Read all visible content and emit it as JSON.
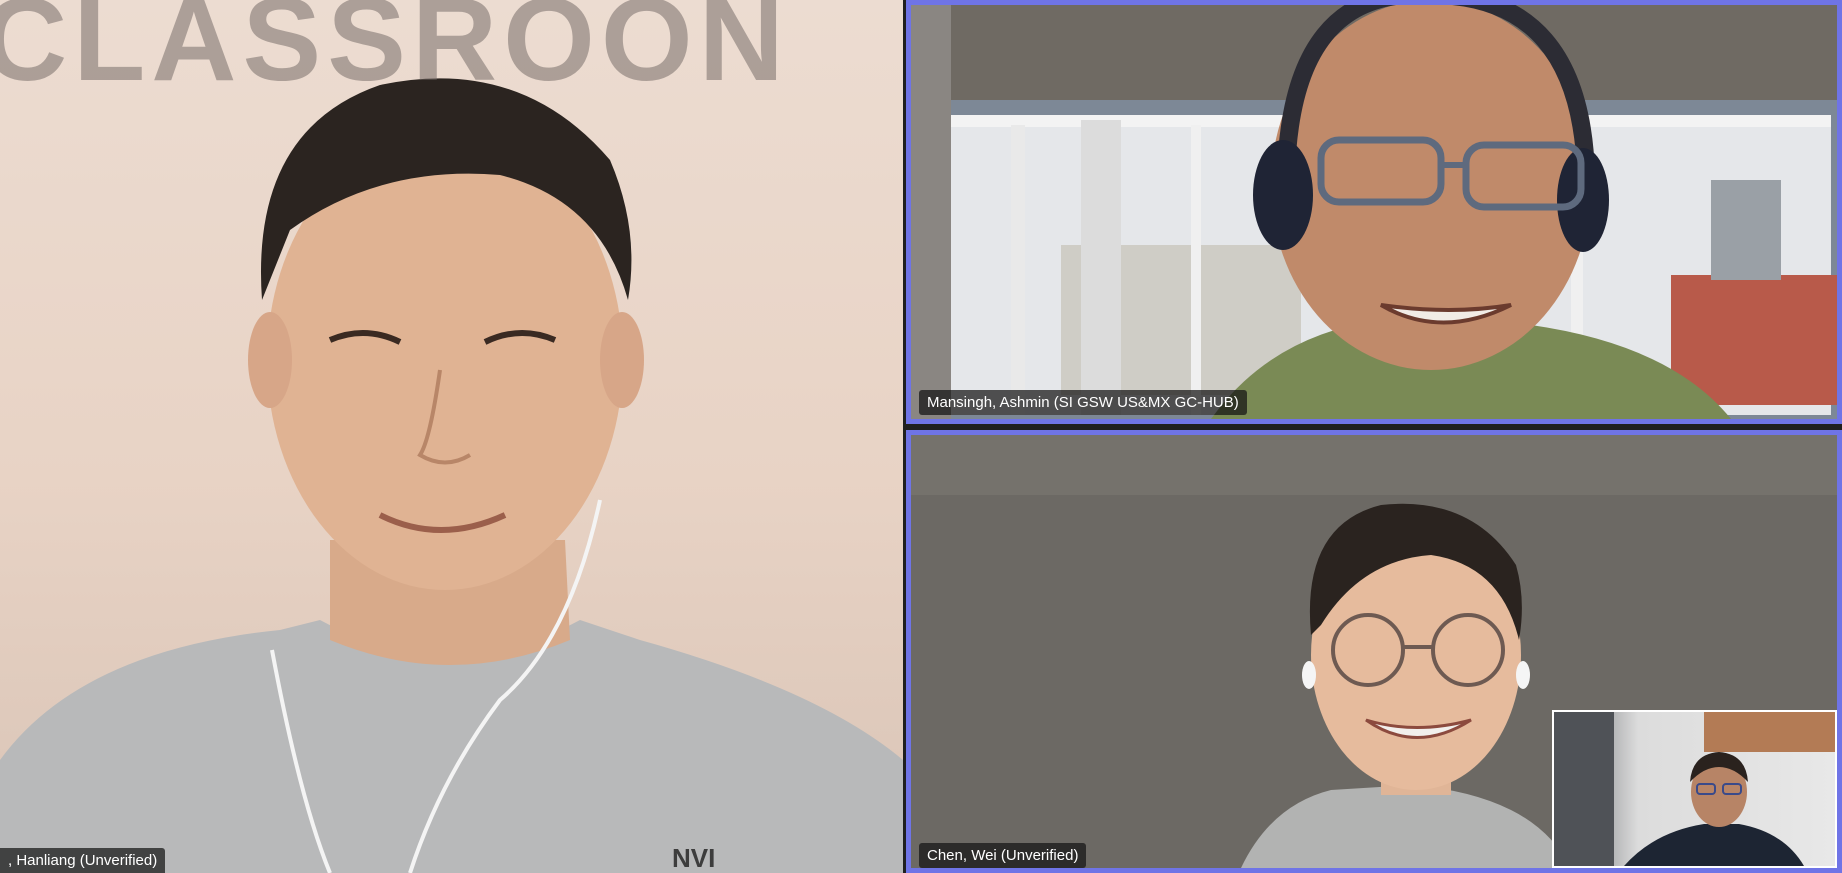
{
  "participants": [
    {
      "display_name": ", Hanliang (Unverified)",
      "wall_text": "CLASSROON",
      "shirt_text": "NVI"
    },
    {
      "display_name": "Mansingh, Ashmin (SI GSW US&MX GC-HUB)"
    },
    {
      "display_name": "Chen, Wei (Unverified)"
    }
  ],
  "colors": {
    "active_border": "#6f74e6",
    "label_bg": "#141414",
    "label_text": "#ffffff"
  },
  "self_view": {
    "icon": "self-video-thumbnail"
  }
}
